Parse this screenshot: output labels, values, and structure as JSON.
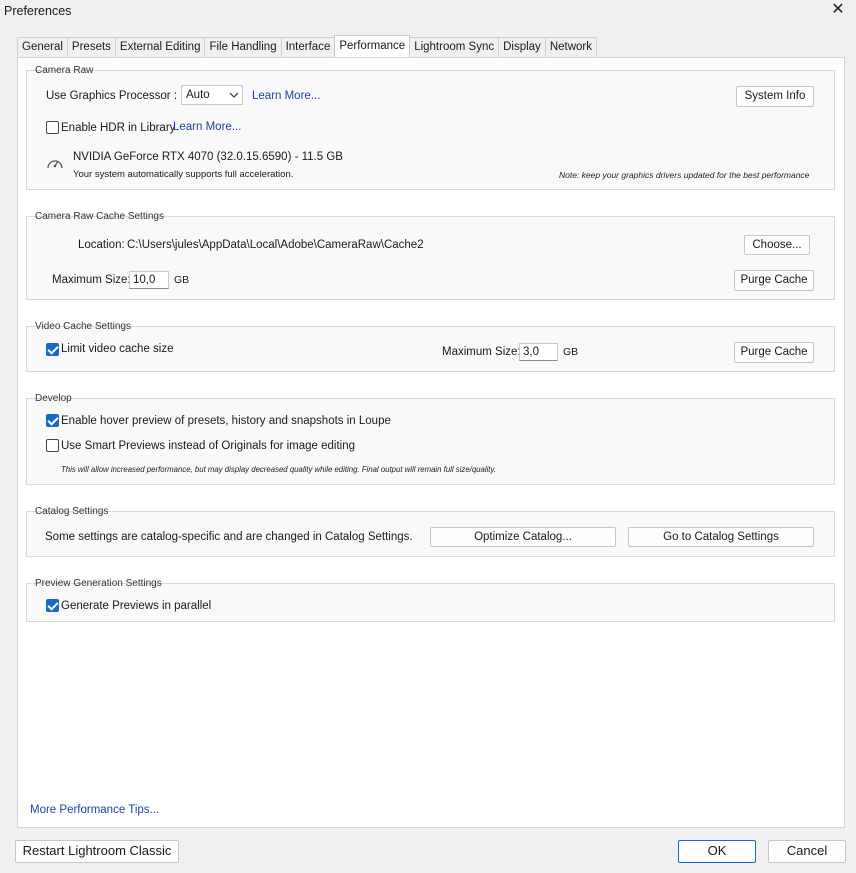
{
  "window": {
    "title": "Preferences"
  },
  "tabs": [
    "General",
    "Presets",
    "External Editing",
    "File Handling",
    "Interface",
    "Performance",
    "Lightroom Sync",
    "Display",
    "Network"
  ],
  "active_tab": "Performance",
  "camera_raw": {
    "title": "Camera Raw",
    "gpu_label": "Use Graphics Processor :",
    "gpu_value": "Auto",
    "learn_more_1": "Learn More...",
    "system_info": "System Info",
    "hdr_label": "Enable HDR in Library",
    "hdr_checked": false,
    "learn_more_2": "Learn More...",
    "gpu_name": "NVIDIA GeForce RTX 4070 (32.0.15.6590) - 11.5 GB",
    "gpu_status": "Your system automatically supports full acceleration.",
    "gpu_note": "Note: keep your graphics drivers updated for the best performance"
  },
  "cache": {
    "title": "Camera Raw Cache Settings",
    "location_label": "Location:",
    "location_value": "C:\\Users\\jules\\AppData\\Local\\Adobe\\CameraRaw\\Cache2",
    "choose": "Choose...",
    "max_label": "Maximum Size:",
    "max_value": "10,0",
    "unit": "GB",
    "purge": "Purge Cache"
  },
  "video_cache": {
    "title": "Video Cache Settings",
    "limit_label": "Limit video cache size",
    "limit_checked": true,
    "max_label": "Maximum Size:",
    "max_value": "3,0",
    "unit": "GB",
    "purge": "Purge Cache"
  },
  "develop": {
    "title": "Develop",
    "hover_label": "Enable hover preview of presets, history and snapshots in Loupe",
    "hover_checked": true,
    "smart_label": "Use Smart Previews instead of Originals for image editing",
    "smart_checked": false,
    "note": "This will allow increased performance, but may display decreased quality while editing. Final output will remain full size/quality."
  },
  "catalog": {
    "title": "Catalog Settings",
    "text": "Some settings are catalog-specific and are changed in Catalog Settings.",
    "optimize": "Optimize Catalog...",
    "goto": "Go to Catalog Settings"
  },
  "preview": {
    "title": "Preview Generation Settings",
    "parallel_label": "Generate Previews in parallel",
    "parallel_checked": true
  },
  "tips_link": "More Performance Tips...",
  "footer": {
    "restart": "Restart Lightroom Classic",
    "ok": "OK",
    "cancel": "Cancel"
  },
  "colors": {
    "accent": "#1769c9",
    "link": "#1f3fa8"
  }
}
